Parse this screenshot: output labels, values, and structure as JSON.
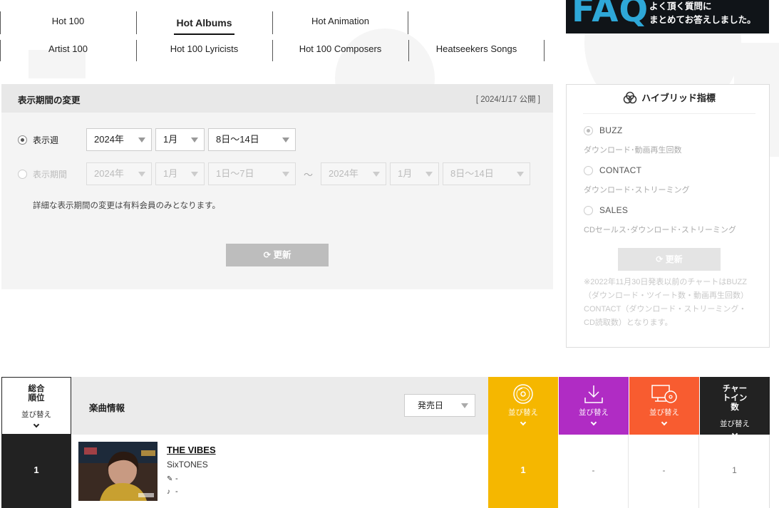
{
  "tabs": {
    "row1": [
      "Hot 100",
      "Hot Albums",
      "Hot Animation"
    ],
    "row2": [
      "Artist 100",
      "Hot 100 Lyricists",
      "Hot 100 Composers",
      "Heatseekers Songs"
    ],
    "active": "Hot Albums"
  },
  "faq": {
    "big": "FAQ",
    "line1": "よく頂く質問に",
    "line2": "まとめてお答えしました。"
  },
  "period": {
    "title": "表示期間の変更",
    "published": "[ 2024/1/17 公開 ]",
    "week_label": "表示週",
    "week_year": "2024年",
    "week_month": "1月",
    "week_range": "8日〜14日",
    "range_label": "表示期間",
    "from_year": "2024年",
    "from_month": "1月",
    "from_range": "1日〜7日",
    "tilde": "〜",
    "to_year": "2024年",
    "to_month": "1月",
    "to_range": "8日〜14日",
    "note": "詳細な表示期間の変更は有料会員のみとなります。",
    "update_label": "更新"
  },
  "hybrid": {
    "title": "ハイブリッド指標",
    "options": [
      {
        "label": "BUZZ",
        "sub": "ダウンロード･動画再生回数",
        "selected": true
      },
      {
        "label": "CONTACT",
        "sub": "ダウンロード･ストリーミング",
        "selected": false
      },
      {
        "label": "SALES",
        "sub": "CDセールス･ダウンロード･ストリーミング",
        "selected": false
      }
    ],
    "update_label": "更新",
    "note": "※2022年11月30日発表以前のチャートはBUZZ（ダウンロード・ツイート数・動画再生回数）CONTACT（ダウンロード・ストリーミング・CD読取数）となります。"
  },
  "chart": {
    "rank_header": "総合順位",
    "info_header": "楽曲情報",
    "sort_select": "発売日",
    "sort_label": "並び替え",
    "chartin_header": "チャートイン数",
    "colors": {
      "sales": "#f5b700",
      "download": "#b02cc4",
      "streaming": "#f85c30",
      "dark": "#222222"
    },
    "rows": [
      {
        "rank": "1",
        "title": "THE VIBES",
        "artist": "SixTONES",
        "lyricist": "-",
        "composer": "-",
        "sales": "1",
        "download": "-",
        "streaming": "-",
        "chart_in": "1"
      }
    ]
  }
}
